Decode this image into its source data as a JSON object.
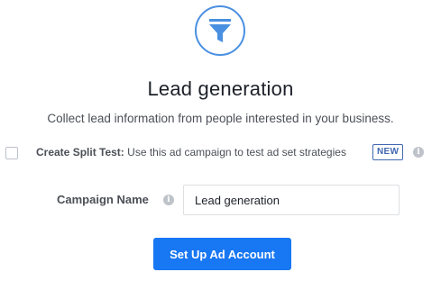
{
  "header": {
    "icon": "funnel-icon",
    "accent_color": "#4a90e2",
    "title": "Lead generation",
    "subtitle": "Collect lead information from people interested in your business."
  },
  "split_test": {
    "checked": false,
    "label_bold": "Create Split Test:",
    "label_text": " Use this ad campaign to test ad set strategies",
    "badge": "NEW",
    "info_icon": "i"
  },
  "campaign": {
    "label": "Campaign Name",
    "info_icon": "i",
    "value": "Lead generation"
  },
  "actions": {
    "setup_label": "Set Up Ad Account",
    "button_color": "#1877f2"
  }
}
